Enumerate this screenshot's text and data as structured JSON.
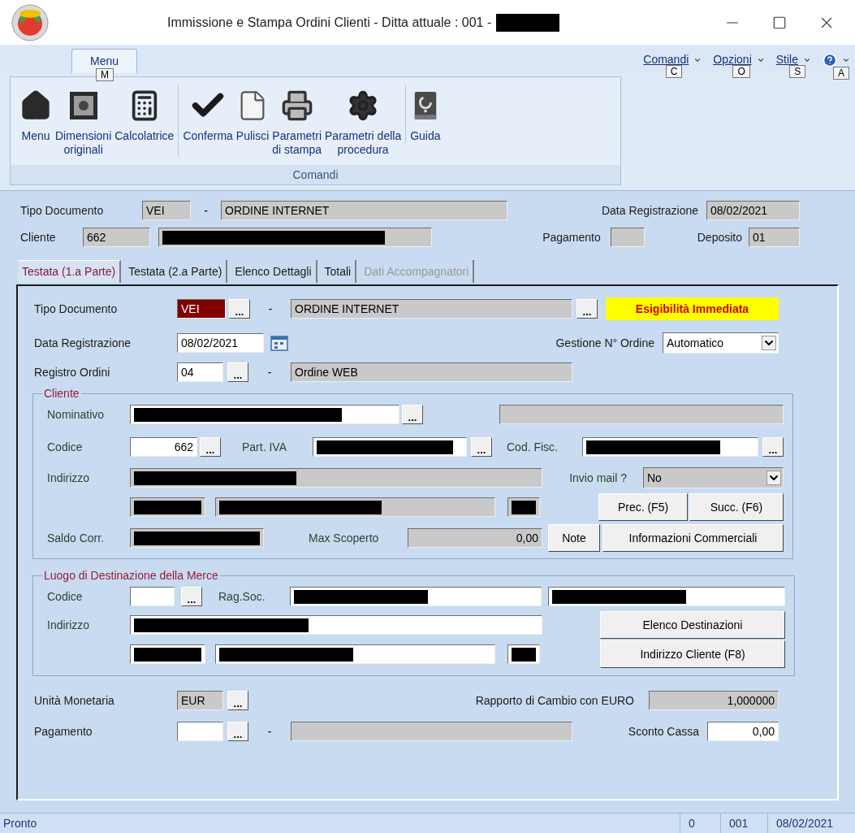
{
  "window": {
    "title": "Immissione e Stampa Ordini Clienti - Ditta attuale : 001 -",
    "title_redacted": true
  },
  "ribbon": {
    "tabs": [
      {
        "label": "Menu",
        "keytip": "M",
        "selected": true
      }
    ],
    "menus": [
      {
        "kind": "menu",
        "label": "Comandi",
        "keytip": "C"
      },
      {
        "kind": "menu",
        "label": "Opzioni",
        "keytip": "O"
      },
      {
        "kind": "menu",
        "label": "Stile",
        "keytip": "S"
      },
      {
        "kind": "help",
        "keytip": "A"
      }
    ],
    "group": {
      "label": "Comandi",
      "sections": [
        [
          {
            "label": "Menu"
          },
          {
            "label": "Dimensioni\noriginali"
          },
          {
            "label": "Calcolatrice"
          }
        ],
        [
          {
            "label": "Conferma"
          },
          {
            "label": "Pulisci"
          },
          {
            "label": "Parametri\ndi stampa"
          },
          {
            "label": "Parametri della\nprocedura"
          }
        ],
        [
          {
            "label": "Guida"
          }
        ]
      ]
    }
  },
  "header": {
    "tipo_documento": {
      "label": "Tipo Documento",
      "code": {
        "value": "VEI",
        "editable": false
      },
      "separator": "-",
      "description": {
        "value": "ORDINE INTERNET",
        "editable": false
      }
    },
    "data_registrazione": {
      "label": "Data Registrazione",
      "field": {
        "value": "08/02/2021",
        "editable": false
      }
    },
    "cliente": {
      "label": "Cliente",
      "code": {
        "value": "662",
        "editable": false
      },
      "name": {
        "editable": false,
        "redacted": true
      }
    },
    "pagamento": {
      "label": "Pagamento",
      "field": {
        "editable": false
      }
    },
    "deposito": {
      "label": "Deposito",
      "field": {
        "value": "01",
        "editable": false
      }
    }
  },
  "tabs": [
    {
      "label": "Testata (1.a Parte)",
      "selected": true,
      "disabled": false
    },
    {
      "label": "Testata (2.a Parte)",
      "selected": false,
      "disabled": false
    },
    {
      "label": "Elenco Dettagli",
      "selected": false,
      "disabled": false
    },
    {
      "label": "Totali",
      "selected": false,
      "disabled": false
    },
    {
      "label": "Dati Accompagnatori",
      "selected": false,
      "disabled": true
    }
  ],
  "form": {
    "tipo_documento": {
      "label": "Tipo Documento",
      "code": {
        "value": "VEI",
        "focused": true
      },
      "code_browse": "...",
      "separator": "-",
      "description": {
        "value": "ORDINE INTERNET",
        "editable": false
      },
      "description_browse": "...",
      "badge": "Esigibilità Immediata"
    },
    "data_registrazione": {
      "label": "Data Registrazione",
      "field": {
        "value": "08/02/2021",
        "editable": true
      }
    },
    "gestione_ordine": {
      "label": "Gestione N° Ordine",
      "dropdown": {
        "value": "Automatico",
        "editable": true
      }
    },
    "registro_ordini": {
      "label": "Registro Ordini",
      "code": {
        "value": "04",
        "editable": true
      },
      "code_browse": "...",
      "separator": "-",
      "description": {
        "value": "Ordine WEB",
        "editable": false
      }
    },
    "cliente": {
      "title": "Cliente",
      "nominativo": {
        "label": "Nominativo",
        "field": {
          "editable": true,
          "redacted": true
        },
        "browse": "...",
        "extra": {
          "editable": false
        }
      },
      "codice": {
        "label": "Codice",
        "field": {
          "value": "662",
          "editable": true
        },
        "browse": "...",
        "piva_label": "Part. IVA",
        "piva": {
          "editable": true,
          "redacted": true
        },
        "piva_browse": "...",
        "cf_label": "Cod. Fisc.",
        "cf": {
          "editable": true,
          "redacted": true
        },
        "cf_browse": "..."
      },
      "indirizzo": {
        "label": "Indirizzo",
        "field": {
          "editable": false,
          "redacted": true
        },
        "mail_label": "Invio mail ?",
        "mail": {
          "value": "No",
          "editable": false
        }
      },
      "localita": {
        "cap": {
          "editable": false,
          "redacted": true
        },
        "citta": {
          "editable": false,
          "redacted": true
        },
        "provincia": {
          "editable": false,
          "redacted": true
        },
        "buttons": [
          "Prec. (F5)",
          "Succ. (F6)"
        ]
      },
      "saldo": {
        "label": "Saldo Corr.",
        "field": {
          "editable": false,
          "redacted": true
        },
        "scoperto_label": "Max Scoperto",
        "scoperto": {
          "value": "0,00",
          "editable": false
        },
        "buttons": [
          "Note",
          "Informazioni Commerciali"
        ]
      }
    },
    "destinazione": {
      "title": "Luogo di Destinazione della Merce",
      "codice": {
        "label": "Codice",
        "field": {
          "editable": true
        },
        "browse": "...",
        "ragsoc_label": "Rag.Soc.",
        "ragsoc": {
          "editable": true,
          "redacted": true
        },
        "ragsoc2": {
          "editable": true,
          "redacted": true
        }
      },
      "indirizzo": {
        "label": "Indirizzo",
        "field": {
          "editable": true,
          "redacted": true
        },
        "button": "Elenco Destinazioni"
      },
      "localita": {
        "cap": {
          "editable": true,
          "redacted": true
        },
        "citta": {
          "editable": true,
          "redacted": true
        },
        "provincia": {
          "editable": true,
          "redacted": true
        },
        "button": "Indirizzo Cliente (F8)"
      }
    },
    "valuta": {
      "label": "Unità Monetaria",
      "field": {
        "value": "EUR",
        "editable": false
      },
      "browse": "...",
      "cambio_label": "Rapporto di Cambio con EURO",
      "cambio": {
        "value": "1,000000",
        "editable": false
      }
    },
    "pagamento": {
      "label": "Pagamento",
      "field": {
        "editable": true
      },
      "browse": "...",
      "separator": "-",
      "description": {
        "editable": false
      },
      "sconto_label": "Sconto Cassa",
      "sconto": {
        "value": "0,00",
        "editable": true
      }
    }
  },
  "status_bar": {
    "text": "Pronto",
    "panels": [
      "0",
      "001",
      "08/02/2021"
    ]
  }
}
